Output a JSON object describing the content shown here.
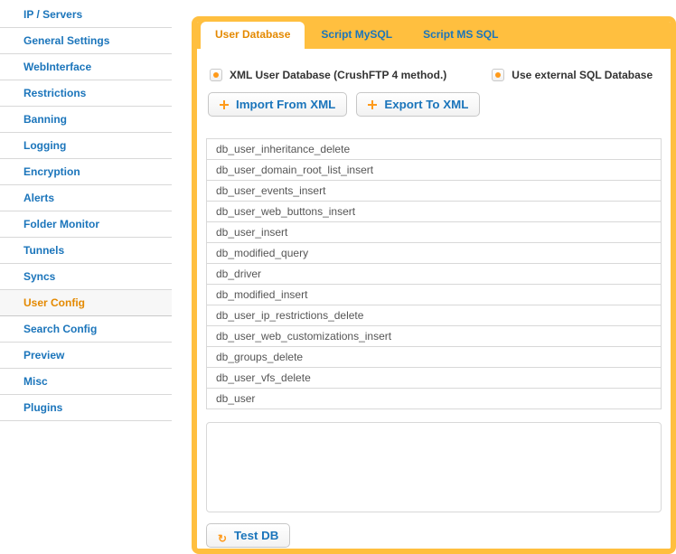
{
  "sidebar": {
    "items": [
      {
        "label": "IP / Servers"
      },
      {
        "label": "General Settings"
      },
      {
        "label": "WebInterface"
      },
      {
        "label": "Restrictions"
      },
      {
        "label": "Banning"
      },
      {
        "label": "Logging"
      },
      {
        "label": "Encryption"
      },
      {
        "label": "Alerts"
      },
      {
        "label": "Folder Monitor"
      },
      {
        "label": "Tunnels"
      },
      {
        "label": "Syncs"
      },
      {
        "label": "User Config"
      },
      {
        "label": "Search Config"
      },
      {
        "label": "Preview"
      },
      {
        "label": "Misc"
      },
      {
        "label": "Plugins"
      }
    ],
    "active_index": 11
  },
  "tabs": {
    "items": [
      {
        "label": "User Database"
      },
      {
        "label": "Script MySQL"
      },
      {
        "label": "Script MS SQL"
      }
    ],
    "active_index": 0
  },
  "radios": {
    "xml": {
      "label": "XML User Database (CrushFTP 4 method.)",
      "selected": true
    },
    "sql": {
      "label": "Use external SQL Database",
      "selected": false
    }
  },
  "buttons": {
    "import": "Import From XML",
    "export": "Export To XML",
    "testdb": "Test DB"
  },
  "db_keys": [
    "db_user_inheritance_delete",
    "db_user_domain_root_list_insert",
    "db_user_events_insert",
    "db_user_web_buttons_insert",
    "db_user_insert",
    "db_modified_query",
    "db_driver",
    "db_modified_insert",
    "db_user_ip_restrictions_delete",
    "db_user_web_customizations_insert",
    "db_groups_delete",
    "db_user_vfs_delete",
    "db_user"
  ]
}
